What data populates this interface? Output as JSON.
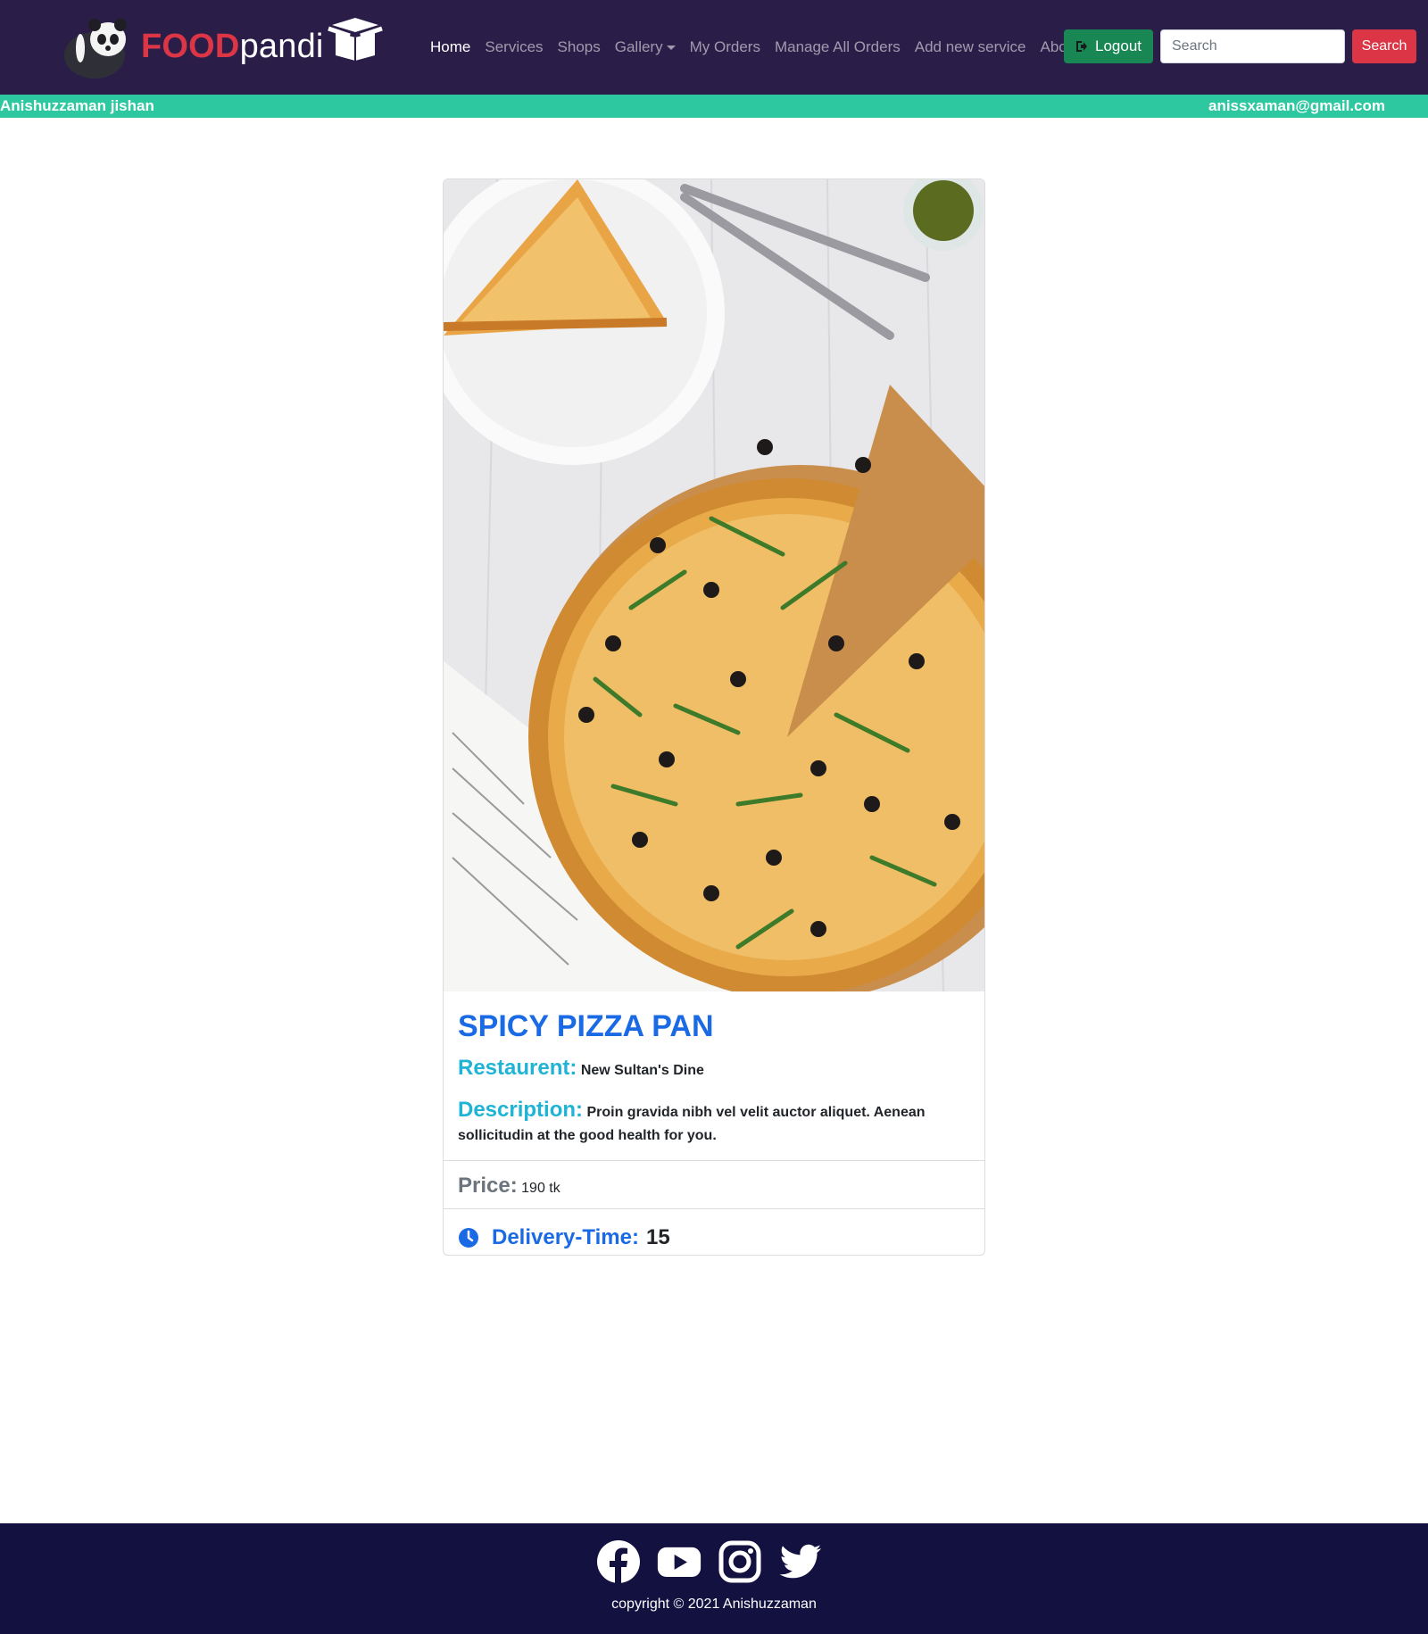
{
  "brand": {
    "food": "FOOD",
    "pandi": "pandi"
  },
  "nav": {
    "items": [
      {
        "label": "Home",
        "active": true
      },
      {
        "label": "Services"
      },
      {
        "label": "Shops"
      },
      {
        "label": "Gallery"
      },
      {
        "label": "My Orders"
      },
      {
        "label": "Manage All Orders"
      },
      {
        "label": "Add new service"
      },
      {
        "label": "About us"
      }
    ],
    "logout_label": "Logout",
    "search_placeholder": "Search",
    "search_button": "Search"
  },
  "user": {
    "name": "Anishuzzaman jishan",
    "email": "anissxaman@gmail.com"
  },
  "card": {
    "title": "SPICY PIZZA PAN",
    "restaurant_label": "Restaurent:",
    "restaurant": "New Sultan's Dine",
    "description_label": "Description:",
    "description": "Proin gravida nibh vel velit auctor aliquet. Aenean sollicitudin at the good health for you.",
    "price_label": "Price:",
    "price": "190 tk",
    "delivery_label": "Delivery-Time:",
    "delivery_time": "15"
  },
  "footer": {
    "icons": [
      "facebook-icon",
      "youtube-icon",
      "instagram-icon",
      "twitter-icon"
    ],
    "copyright": "copyright © 2021 Anishuzzaman"
  },
  "colors": {
    "navbar": "#2a1e48",
    "userbar": "#2ec8a0",
    "footer": "#131140",
    "title_blue": "#1a6ae6",
    "label_cyan": "#1fb3d6",
    "danger": "#dc3545",
    "success": "#198754"
  }
}
